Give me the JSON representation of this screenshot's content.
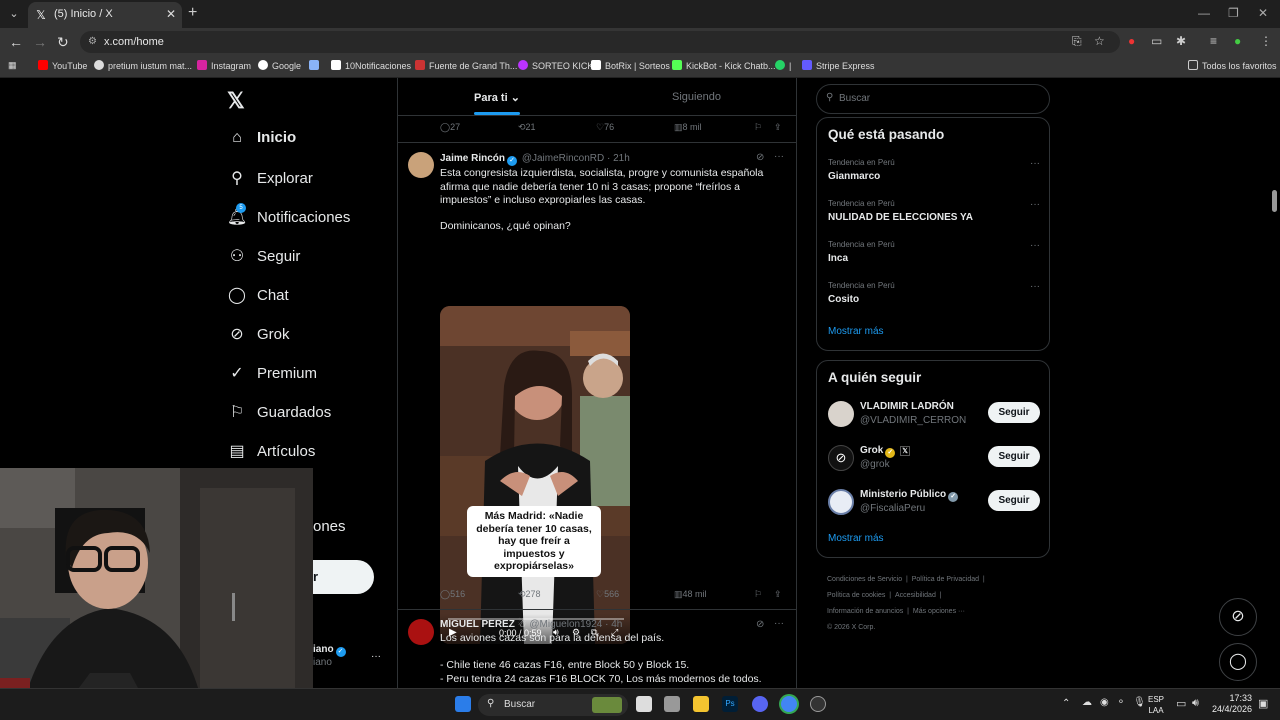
{
  "browser": {
    "tab_title": "(5) Inicio / X",
    "url": "x.com/home",
    "bookmarks": [
      "YouTube",
      "pretium iustum mat...",
      "Instagram",
      "Google",
      "10Notificaciones",
      "Fuente de Grand Th...",
      "SORTEO KICK",
      "BotRix | Sorteos",
      "KickBot - Kick Chatb...",
      "Stripe Express"
    ],
    "all_bookmarks": "Todos los favoritos"
  },
  "sidebar": {
    "items": [
      {
        "label": "Inicio",
        "icon": "home-icon"
      },
      {
        "label": "Explorar",
        "icon": "search-icon"
      },
      {
        "label": "Notificaciones",
        "icon": "bell-icon",
        "badge": "5"
      },
      {
        "label": "Seguir",
        "icon": "person-add-icon"
      },
      {
        "label": "Chat",
        "icon": "chat-icon"
      },
      {
        "label": "Grok",
        "icon": "grok-icon"
      },
      {
        "label": "Premium",
        "icon": "premium-icon"
      },
      {
        "label": "Guardados",
        "icon": "bookmark-icon"
      },
      {
        "label": "Artículos",
        "icon": "article-icon"
      }
    ],
    "partial_more": "ones",
    "partial_post_button": "r",
    "partial_profile_name": "iano",
    "partial_profile_handle": "iano",
    "profile_more": "···"
  },
  "feed": {
    "tabs": {
      "for_you": "Para ti",
      "following": "Siguiendo"
    },
    "prev_actions": {
      "replies": "27",
      "reposts": "21",
      "likes": "76",
      "views": "8 mil"
    },
    "tweet1": {
      "name": "Jaime Rincón",
      "handle": "@JaimeRinconRD",
      "time": "· 21h",
      "text": "Esta congresista izquierdista, socialista, progre y comunista española afirma que nadie debería tener 10 ni 3 casas; propone “freírlos a impuestos” e incluso expropiarles las casas.",
      "text2": "Dominicanos, ¿qué opinan?",
      "video_caption": "Más Madrid: «Nadie debería tener 10 casas, hay que freír a impuestos y expropiárselas»",
      "video_time": "0:00 / 0:59",
      "actions": {
        "replies": "516",
        "reposts": "278",
        "likes": "566",
        "views": "48 mil"
      }
    },
    "tweet2": {
      "name": "MIGUEL PEREZ",
      "handle": "@Miguelon1924",
      "time": "· 4h",
      "text": "Los aviones cazas son para la defensa del país.",
      "line1": "- Chile tiene 46 cazas F16, entre Block 50 y Block 15.",
      "line2": "- Peru tendra 24 cazas F16 BLOCK 70, Los más modernos de todos."
    }
  },
  "right": {
    "search_placeholder": "Buscar",
    "trending_title": "Qué está pasando",
    "trends": [
      {
        "context": "Tendencia en Perú",
        "name": "Gianmarco"
      },
      {
        "context": "Tendencia en Perú",
        "name": "NULIDAD DE ELECCIONES YA"
      },
      {
        "context": "Tendencia en Perú",
        "name": "Inca"
      },
      {
        "context": "Tendencia en Perú",
        "name": "Cosito"
      }
    ],
    "show_more": "Mostrar más",
    "follow_title": "A quién seguir",
    "follows": [
      {
        "name": "VLADIMIR LADRÓN",
        "handle": "@VLADIMIR_CERRON",
        "button": "Seguir"
      },
      {
        "name": "Grok",
        "handle": "@grok",
        "button": "Seguir"
      },
      {
        "name": "Ministerio Público",
        "handle": "@FiscaliaPeru",
        "button": "Seguir"
      }
    ],
    "footer": {
      "l1a": "Condiciones de Servicio",
      "l1b": "Política de Privacidad",
      "l2a": "Política de cookies",
      "l2b": "Accesibilidad",
      "l3a": "Información de anuncios",
      "l3b": "Más opciones ···",
      "l4": "© 2026 X Corp."
    }
  },
  "taskbar": {
    "search": "Buscar",
    "lang1": "ESP",
    "lang2": "LAA",
    "time": "17:33",
    "date": "24/4/2026"
  },
  "colors": {
    "accent": "#1d9bf0",
    "bg": "#000000",
    "border": "#2f3336",
    "muted": "#71767b"
  }
}
